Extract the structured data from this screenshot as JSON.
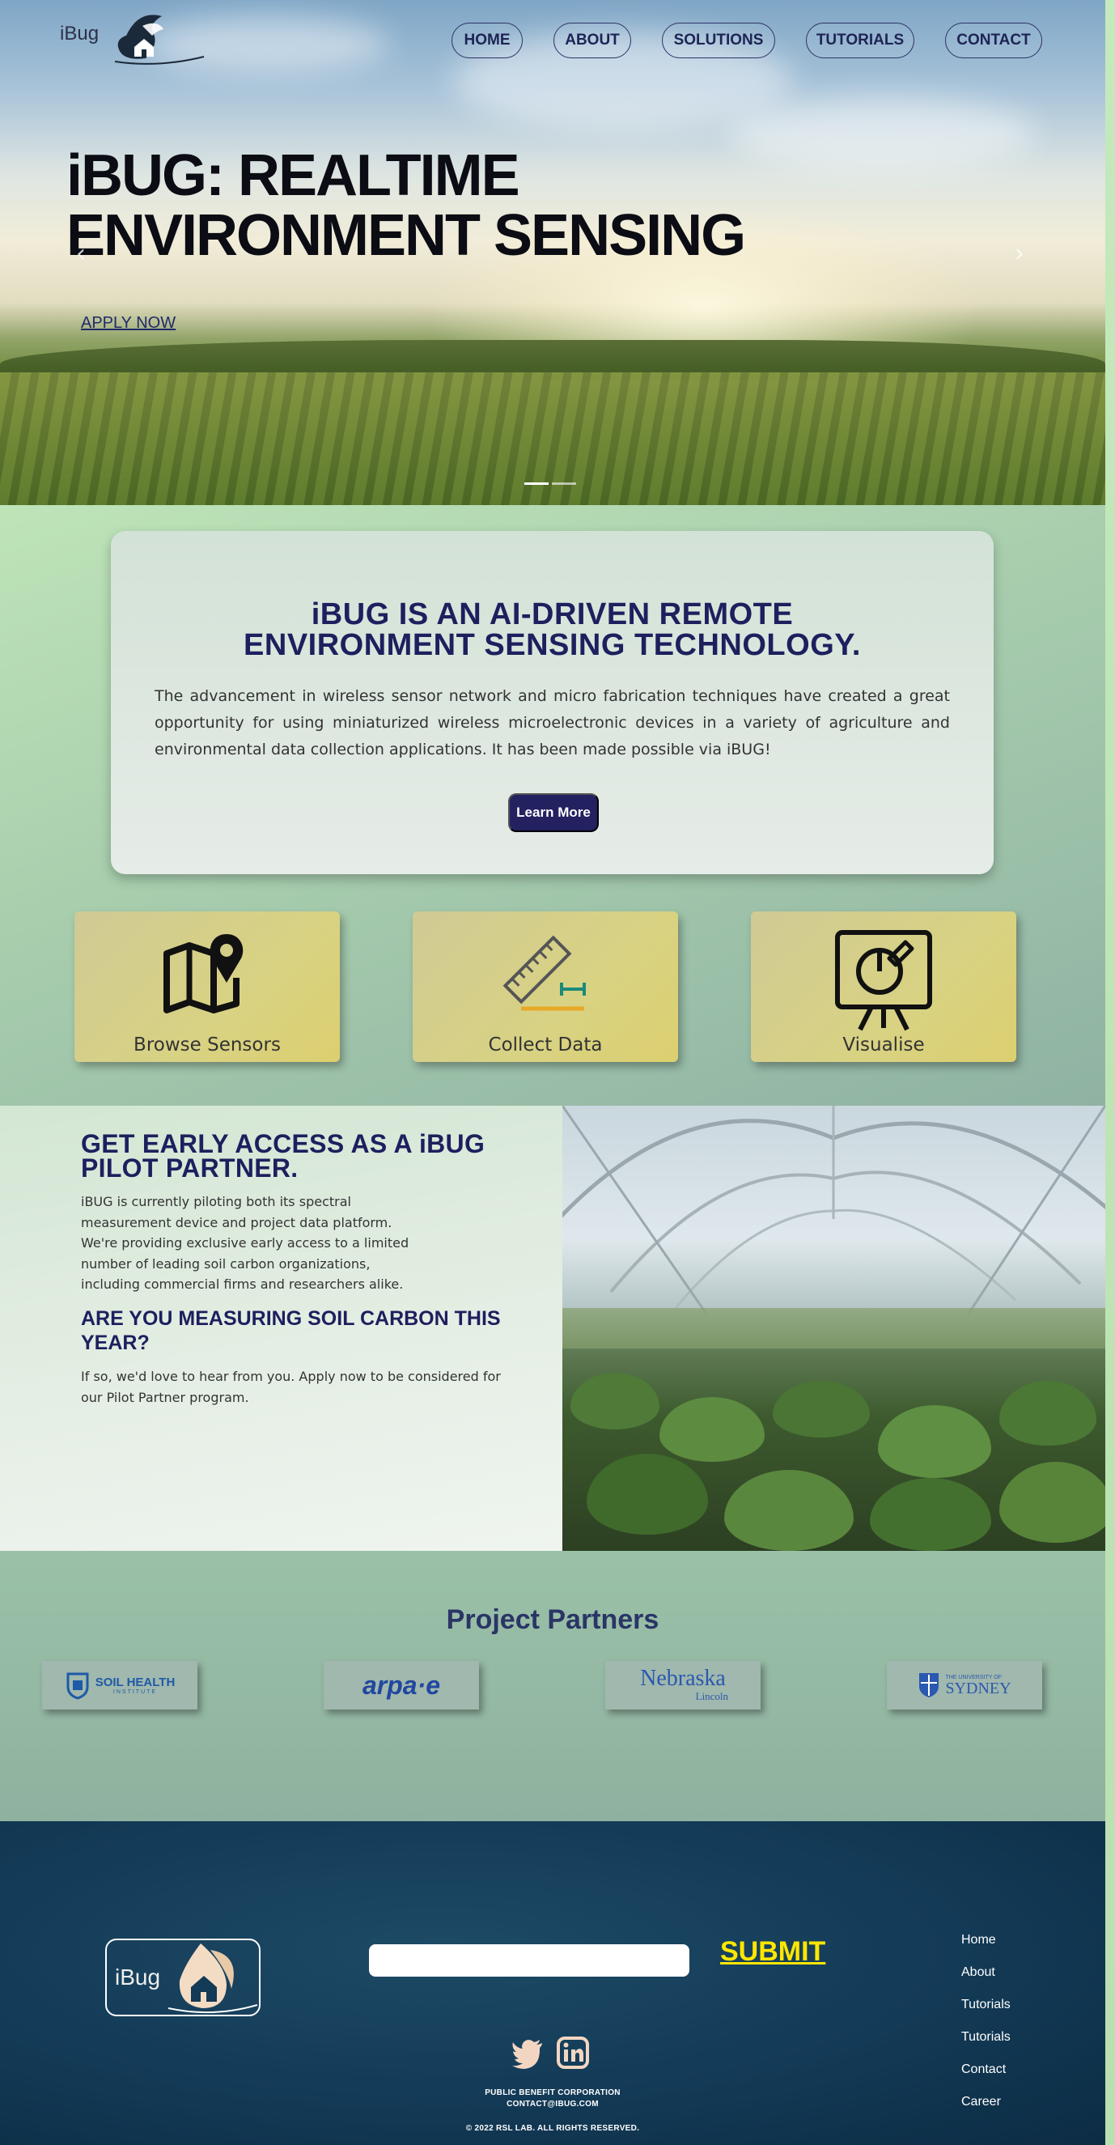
{
  "brand": {
    "logo_text": "iBug"
  },
  "nav": {
    "items": [
      {
        "label": "HOME"
      },
      {
        "label": "ABOUT"
      },
      {
        "label": "SOLUTIONS"
      },
      {
        "label": "TUTORIALS"
      },
      {
        "label": "CONTACT"
      }
    ]
  },
  "hero": {
    "title_line1": "iBUG: REALTIME",
    "title_line2": "ENVIRONMENT SENSING",
    "apply_label": "APPLY NOW",
    "prev_icon": "chevron-left-icon",
    "next_icon": "chevron-right-icon",
    "slide_count": 2,
    "active_slide": 1
  },
  "intro": {
    "title_line1": "iBUG IS AN AI-DRIVEN REMOTE",
    "title_line2": "ENVIRONMENT SENSING TECHNOLOGY.",
    "body": "The advancement in wireless sensor network and micro fabrication techniques have created a great opportunity for using miniaturized wireless microelectronic devices in a variety of agriculture and environmental data collection applications. It has been made possible via iBUG!",
    "button_label": "Learn More"
  },
  "features": [
    {
      "label": "Browse Sensors",
      "icon": "map-pin-icon"
    },
    {
      "label": "Collect Data",
      "icon": "ruler-icon"
    },
    {
      "label": "Visualise",
      "icon": "presentation-chart-icon"
    }
  ],
  "pilot": {
    "heading1": "GET EARLY ACCESS AS A iBUG PILOT PARTNER.",
    "para1": "iBUG is currently piloting both its spectral measurement device and project data platform. We're providing exclusive early access to a limited number of leading soil carbon organizations, including commercial firms and researchers alike.",
    "heading2": "ARE YOU MEASURING SOIL CARBON THIS YEAR?",
    "para2": "If so, we'd love to hear from you. Apply now to be considered for our Pilot Partner program."
  },
  "partners": {
    "title": "Project Partners",
    "items": [
      {
        "name": "SOIL HEALTH",
        "sub": "INSTITUTE"
      },
      {
        "name": "arpa·e",
        "sub": ""
      },
      {
        "name": "Nebraska",
        "sub": "Lincoln"
      },
      {
        "name": "SYDNEY",
        "sub": "THE UNIVERSITY OF"
      }
    ]
  },
  "footer": {
    "logo_text": "iBug",
    "submit_label": "SUBMIT",
    "email_placeholder": "",
    "links": [
      {
        "label": "Home"
      },
      {
        "label": "About"
      },
      {
        "label": "Tutorials"
      },
      {
        "label": "Tutorials"
      },
      {
        "label": "Contact"
      },
      {
        "label": "Career"
      }
    ],
    "social": [
      {
        "icon": "twitter-icon"
      },
      {
        "icon": "linkedin-icon"
      }
    ],
    "line1": "PUBLIC BENEFIT CORPORATION",
    "line2": "CONTACT@IBUG.COM",
    "copyright": "© 2022 RSL LAB. ALL RIGHTS RESERVED."
  },
  "colors": {
    "navy": "#1e1f5e",
    "button": "#232160",
    "submit": "#ffe600",
    "footer_bg": "#133a56",
    "feature_card": "#d8d283"
  }
}
